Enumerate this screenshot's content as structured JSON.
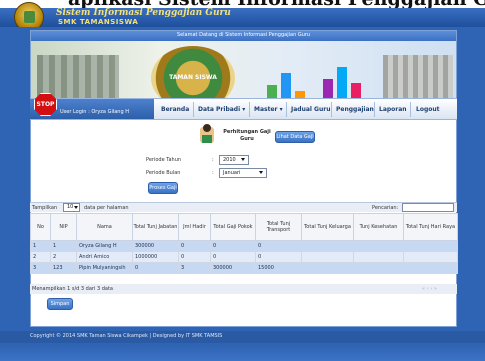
{
  "document": {
    "heading": "aplikasi Sistem Informasi Penggajian Guru"
  },
  "header": {
    "system_title": "Sistem Informasi Penggajian Guru",
    "school": "SMK TAMANSISWA"
  },
  "welcome_text": "Selamat Datang di Sistem Informasi Penggajian Guru",
  "banner": {
    "emblem_text": "TAMAN SISWA"
  },
  "user": {
    "login_text": "User Login : Oryza Gilang H",
    "stop_label": "STOP"
  },
  "nav": {
    "items": [
      {
        "label": "Beranda"
      },
      {
        "label": "Data Pribadi ▾"
      },
      {
        "label": "Master ▾"
      },
      {
        "label": "Jadual Guru"
      },
      {
        "label": "Penggajian"
      },
      {
        "label": "Laporan"
      },
      {
        "label": "Logout"
      }
    ]
  },
  "form": {
    "title": "Perhitungan Gaji Guru",
    "view_button": "Lihat Data Gaji",
    "periode_tahun_label": "Periode Tahun",
    "periode_tahun_value": "2010",
    "periode_bulan_label": "Periode Bulan",
    "periode_bulan_value": "Januari",
    "process_button": "Proses Gaji"
  },
  "table_controls": {
    "show_label": "Tampilkan",
    "page_size": "10",
    "per_page_suffix": "data per halaman",
    "search_label": "Pencarian:",
    "search_value": ""
  },
  "table": {
    "headers": [
      "No",
      "NIP",
      "Nama",
      "Total Tunj Jabatan",
      "Jml Hadir",
      "Total Gaji Pokok",
      "Total Tunj Transport",
      "Total Tunj Keluarga",
      "Tunj Kesehatan",
      "Total Tunj Hari Raya"
    ],
    "rows": [
      [
        "1",
        "1",
        "Oryza Gilang H",
        "300000",
        "0",
        "0",
        "0",
        "",
        "",
        ""
      ],
      [
        "2",
        "2",
        "Andri Amico",
        "1000000",
        "0",
        "0",
        "0",
        "",
        "",
        ""
      ],
      [
        "3",
        "123",
        "Pipin Mulyaningsih",
        "0",
        "3",
        "300000",
        "15000",
        "",
        "",
        ""
      ]
    ],
    "footer": "Menampilkan 1 s/d 3 dari 3 data",
    "pagination": "« ‹ › »"
  },
  "save_button": "Simpan",
  "footer": "Copyright © 2014 SMK Taman Siswa Cikampek | Designed by IT SMK TAMSIS",
  "colors": {
    "primary": "#2f63b3",
    "nav_text": "#1e3f70",
    "row_odd": "#c7d8f2",
    "row_even": "#e3ebf8",
    "stop": "#d40f12"
  }
}
